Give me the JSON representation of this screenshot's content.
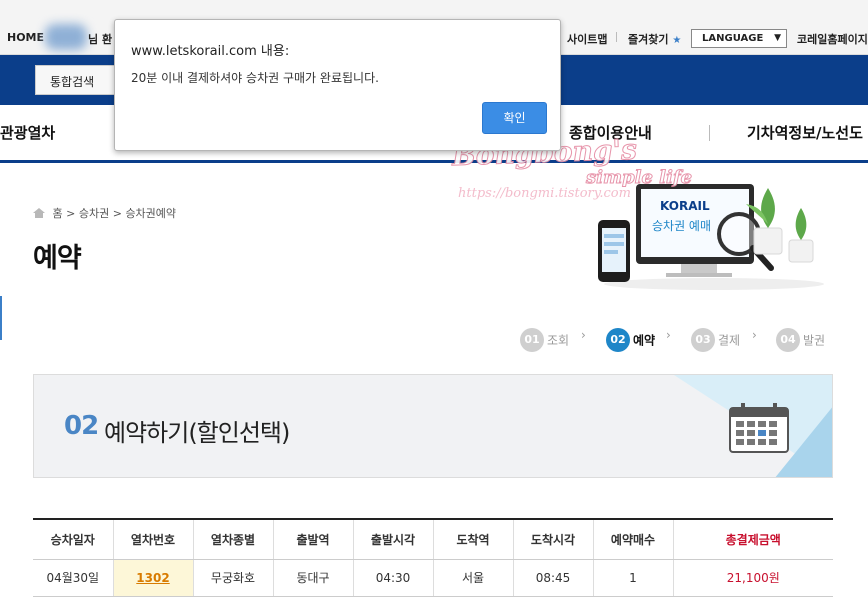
{
  "topbar": {
    "home": "HOME",
    "welcome_suffix": "님 환",
    "links": [
      "사이트맵",
      "즐겨찾기",
      "코레일홈페이지"
    ],
    "favorites_star": "★",
    "language": "LANGUAGE"
  },
  "search": {
    "button_label": "통합검색"
  },
  "mainnav": {
    "items": [
      "관광열차",
      "종합이용안내",
      "기차역정보/노선도"
    ]
  },
  "breadcrumb": {
    "items": [
      "홈",
      "승차권",
      "승차권예약"
    ]
  },
  "page_title": "예약",
  "hero": {
    "brand": "KORAIL",
    "text": "승차권 예매"
  },
  "steps": [
    {
      "num": "01",
      "label": "조회",
      "active": false
    },
    {
      "num": "02",
      "label": "예약",
      "active": true
    },
    {
      "num": "03",
      "label": "결제",
      "active": false
    },
    {
      "num": "04",
      "label": "발권",
      "active": false
    }
  ],
  "banner": {
    "step_num": "02",
    "title": "예약하기(할인선택)"
  },
  "table": {
    "headers": [
      "승차일자",
      "열차번호",
      "열차종별",
      "출발역",
      "출발시각",
      "도착역",
      "도착시각",
      "예약매수",
      "총결제금액"
    ],
    "row": {
      "date": "04월30일",
      "train_no": "1302",
      "train_type": "무궁화호",
      "departure_station": "동대구",
      "departure_time": "04:30",
      "arrival_station": "서울",
      "arrival_time": "08:45",
      "count": "1",
      "total": "21,100원"
    }
  },
  "watermark": {
    "line1": "Bongbong's",
    "line2": "simple life",
    "url": "https://bongmi.tistory.com"
  },
  "dialog": {
    "title": "www.letskorail.com 내용:",
    "message": "20분 이내 결제하셔야 승차권 구매가 완료됩니다.",
    "ok_label": "확인"
  },
  "colors": {
    "brand_blue": "#0b3e8a",
    "accent_blue": "#1e86c8",
    "alert_button": "#3b8de5",
    "price_red": "#c8102e"
  }
}
